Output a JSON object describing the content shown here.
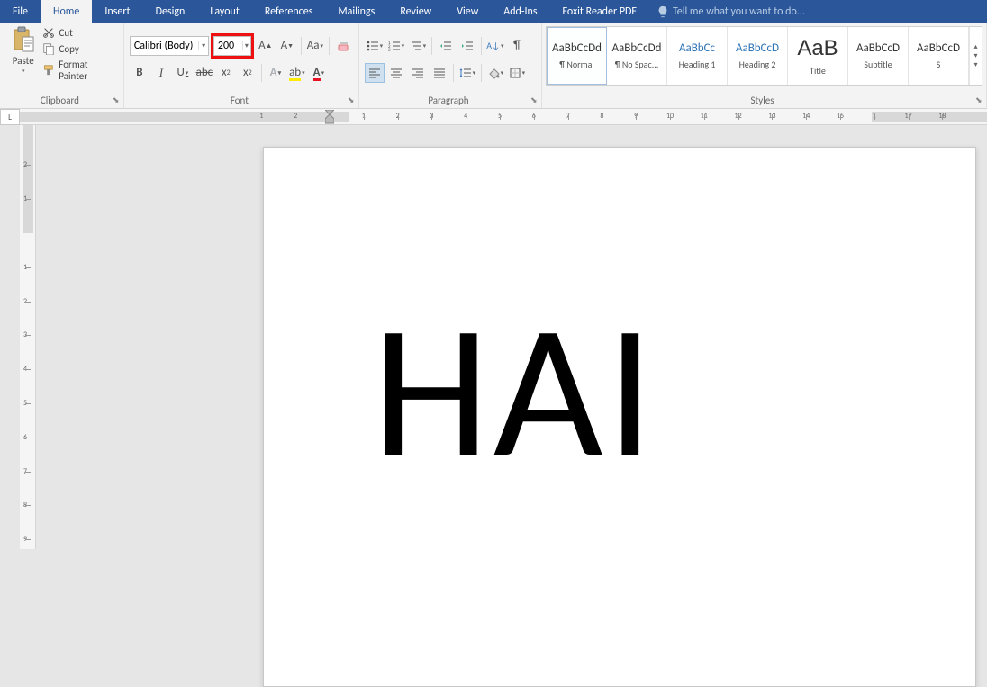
{
  "tabs": {
    "file": "File",
    "home": "Home",
    "insert": "Insert",
    "design": "Design",
    "layout": "Layout",
    "references": "References",
    "mailings": "Mailings",
    "review": "Review",
    "view": "View",
    "addins": "Add-Ins",
    "foxit": "Foxit Reader PDF"
  },
  "tell_me_placeholder": "Tell me what you want to do...",
  "clipboard": {
    "paste": "Paste",
    "cut": "Cut",
    "copy": "Copy",
    "format_painter": "Format Painter",
    "label": "Clipboard"
  },
  "font": {
    "name": "Calibri (Body)",
    "size": "200",
    "label": "Font"
  },
  "paragraph": {
    "label": "Paragraph"
  },
  "styles": {
    "label": "Styles",
    "items": [
      {
        "preview": "AaBbCcDd",
        "name": "¶ Normal",
        "cls": ""
      },
      {
        "preview": "AaBbCcDd",
        "name": "¶ No Spac...",
        "cls": ""
      },
      {
        "preview": "AaBbCc",
        "name": "Heading 1",
        "cls": "heading"
      },
      {
        "preview": "AaBbCcD",
        "name": "Heading 2",
        "cls": "heading"
      },
      {
        "preview": "AaB",
        "name": "Title",
        "cls": "title"
      },
      {
        "preview": "AaBbCcD",
        "name": "Subtitle",
        "cls": ""
      },
      {
        "preview": "AaBbCcD",
        "name": "S",
        "cls": ""
      }
    ]
  },
  "ruler": {
    "h_left_nums": [
      "2",
      "1"
    ],
    "h_main_nums": [
      "1",
      "2",
      "3",
      "4",
      "5",
      "6",
      "7",
      "8",
      "9",
      "10",
      "11",
      "12",
      "13",
      "14",
      "15",
      "1",
      "17",
      "18"
    ]
  },
  "vruler_nums": [
    "2",
    "1",
    "1",
    "2",
    "3",
    "4",
    "5",
    "6",
    "7",
    "8",
    "9"
  ],
  "document": {
    "text": "HAI"
  }
}
